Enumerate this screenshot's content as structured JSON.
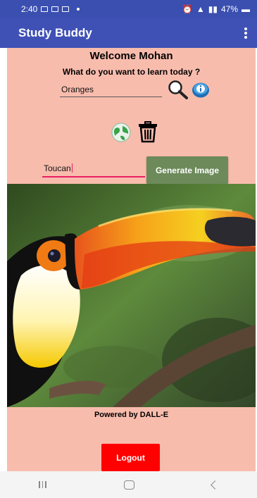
{
  "status_bar": {
    "time": "2:40",
    "battery": "47%"
  },
  "app_bar": {
    "title": "Study Buddy",
    "menu_icon": "more-vert-icon"
  },
  "main": {
    "welcome": "Welcome  Mohan",
    "question": "What do you want to learn today ?",
    "topic_input_value": "Oranges",
    "prompt_input_value": "Toucan",
    "generate_button": "Generate Image",
    "powered_by": "Powered by DALL-E",
    "logout_button": "Logout",
    "generated_image_subject": "toucan"
  },
  "colors": {
    "app_bar": "#3f51b5",
    "content_background": "#f8bcad",
    "generate_button": "#6c8a5a",
    "logout_button": "#ff0000",
    "input_focus_underline": "#e91e63"
  }
}
